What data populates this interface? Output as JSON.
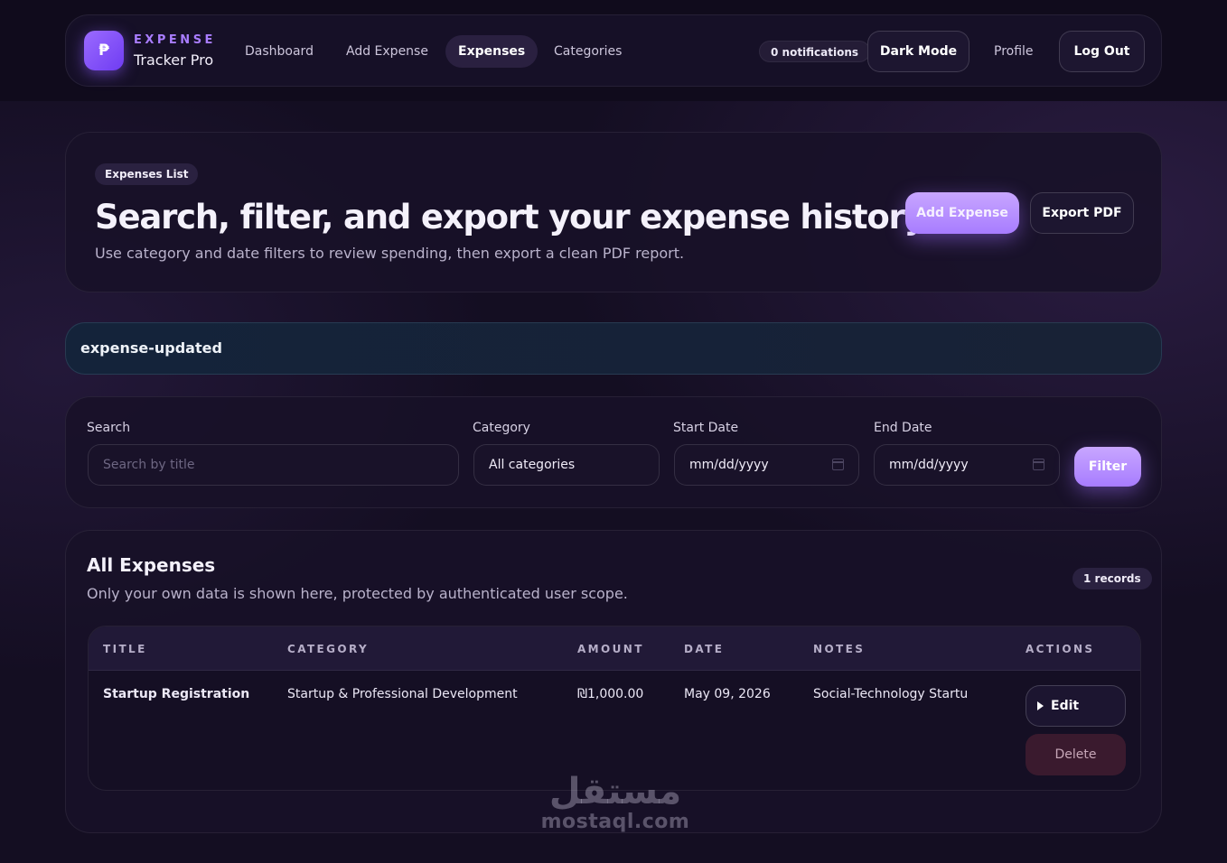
{
  "nav": {
    "logo_glyph": "₱",
    "brand_top": "EXPENSE",
    "brand_bottom": "Tracker Pro",
    "links": [
      "Dashboard",
      "Add Expense",
      "Expenses",
      "Categories"
    ],
    "active_link": "Expenses",
    "notifications": "0 notifications",
    "dark_mode": "Dark Mode",
    "profile": "Profile",
    "logout": "Log Out"
  },
  "hero": {
    "pill": "Expenses List",
    "title": "Search, filter, and export your expense history.",
    "subtitle": "Use category and date filters to review spending, then export a clean PDF report.",
    "add_button": "Add Expense",
    "export_button": "Export PDF"
  },
  "alert": {
    "message": "expense-updated"
  },
  "filters": {
    "search_label": "Search",
    "search_placeholder": "Search by title",
    "category_label": "Category",
    "category_value": "All categories",
    "start_label": "Start Date",
    "start_value": "mm/dd/yyyy",
    "end_label": "End Date",
    "end_value": "mm/dd/yyyy",
    "filter_button": "Filter"
  },
  "expenses": {
    "title": "All Expenses",
    "subtitle": "Only your own data is shown here, protected by authenticated user scope.",
    "records": "1 records",
    "columns": [
      "TITLE",
      "CATEGORY",
      "AMOUNT",
      "DATE",
      "NOTES",
      "ACTIONS"
    ],
    "rows": [
      {
        "title": "Startup Registration",
        "category": "Startup & Professional Development",
        "amount": "₪1,000.00",
        "date": "May 09, 2026",
        "notes": "Social-Technology Startu",
        "edit": "Edit",
        "delete": "Delete"
      }
    ]
  },
  "watermark": {
    "arabic": "مستقل",
    "latin": "mostaql.com"
  },
  "colors": {
    "accent": "#a77cff",
    "background": "#140e22",
    "card": "#181128",
    "danger_bg": "#3a1a2e"
  }
}
